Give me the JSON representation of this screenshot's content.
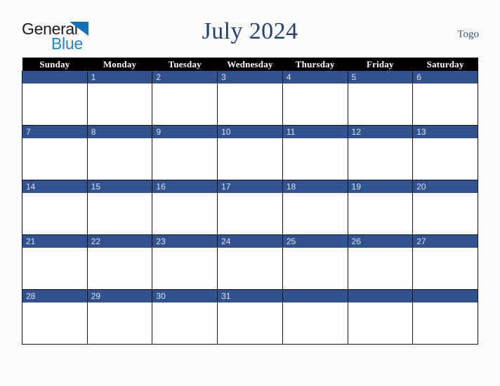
{
  "document": {
    "type": "monthly-calendar",
    "title": "July 2024",
    "month": "July",
    "year": "2024",
    "region": "Togo"
  },
  "brand": {
    "name_part1": "General",
    "name_part2": "Blue",
    "triangle_icon": "triangle-icon",
    "color_part1": "#1b1b1b",
    "color_part2": "#1f86cc",
    "color_triangle": "#1371b8"
  },
  "colors": {
    "page_background": "#fcfcfc",
    "title_text": "#24406e",
    "region_text": "#3f5680",
    "header_row_background": "#000000",
    "header_row_text": "#ffffff",
    "date_band_background": "#30528e",
    "date_band_text": "#dfe4ee",
    "cell_background": "#fdfdfd",
    "grid_border": "#111111"
  },
  "calendar": {
    "weekday_headers": [
      "Sunday",
      "Monday",
      "Tuesday",
      "Wednesday",
      "Thursday",
      "Friday",
      "Saturday"
    ],
    "weeks": [
      [
        "",
        "1",
        "2",
        "3",
        "4",
        "5",
        "6"
      ],
      [
        "7",
        "8",
        "9",
        "10",
        "11",
        "12",
        "13"
      ],
      [
        "14",
        "15",
        "16",
        "17",
        "18",
        "19",
        "20"
      ],
      [
        "21",
        "22",
        "23",
        "24",
        "25",
        "26",
        "27"
      ],
      [
        "28",
        "29",
        "30",
        "31",
        "",
        "",
        ""
      ]
    ]
  }
}
